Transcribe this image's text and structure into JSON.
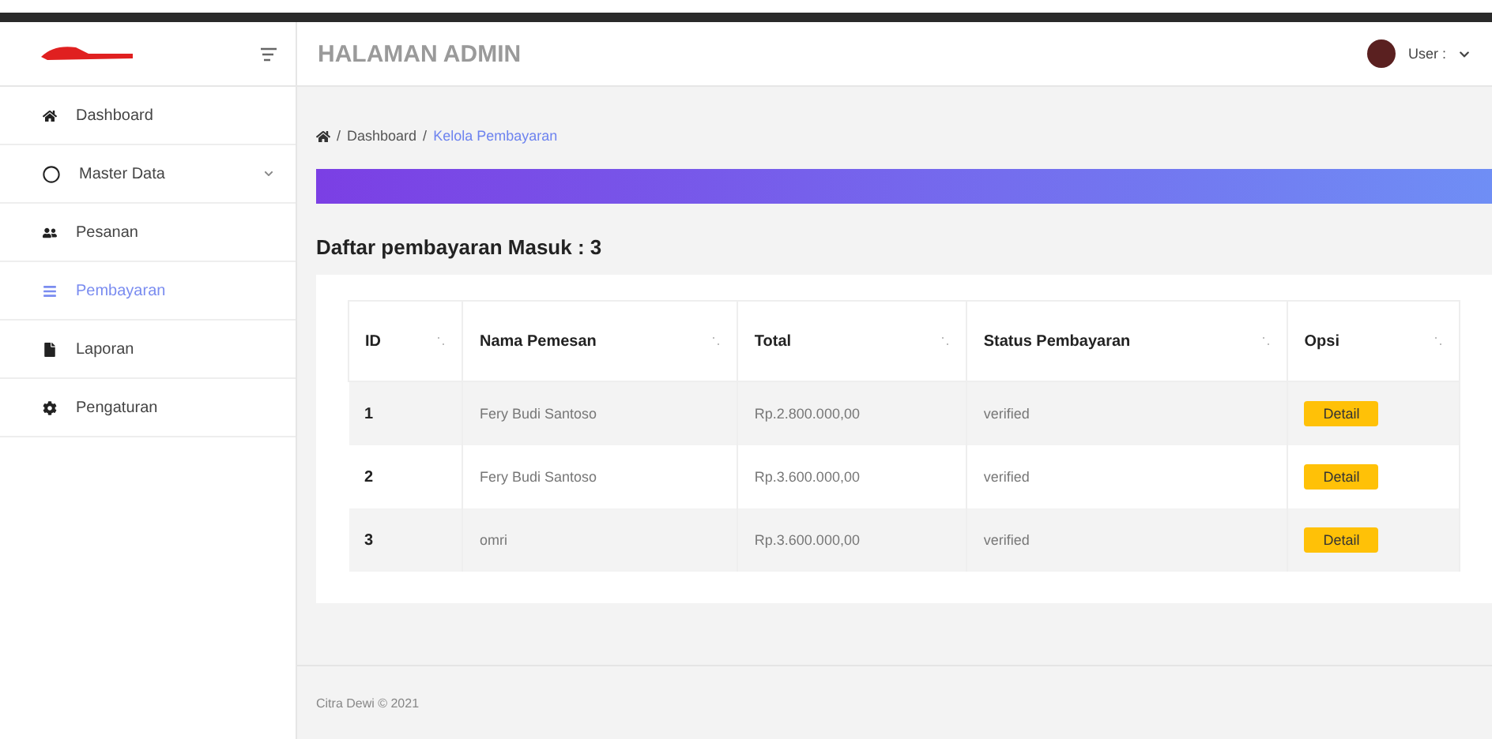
{
  "header": {
    "title": "HALAMAN ADMIN",
    "user_label": "User :"
  },
  "sidebar": {
    "items": [
      {
        "label": "Dashboard",
        "selected": false,
        "expandable": false
      },
      {
        "label": "Master Data",
        "selected": false,
        "expandable": true
      },
      {
        "label": "Pesanan",
        "selected": false,
        "expandable": false
      },
      {
        "label": "Pembayaran",
        "selected": true,
        "expandable": false
      },
      {
        "label": "Laporan",
        "selected": false,
        "expandable": false
      },
      {
        "label": "Pengaturan",
        "selected": false,
        "expandable": false
      }
    ]
  },
  "breadcrumb": [
    {
      "separator": "/",
      "label": "Dashboard",
      "current": false
    },
    {
      "separator": "/",
      "label": "Kelola Pembayaran",
      "current": true
    }
  ],
  "heading": "Daftar pembayaran Masuk : 3",
  "table": {
    "columns": [
      "ID",
      "Nama Pemesan",
      "Total",
      "Status Pembayaran",
      "Opsi"
    ],
    "rows": [
      {
        "id": "1",
        "name": "Fery Budi Santoso",
        "total": "Rp.2.800.000,00",
        "status": "verified",
        "action": "Detail"
      },
      {
        "id": "2",
        "name": "Fery Budi Santoso",
        "total": "Rp.3.600.000,00",
        "status": "verified",
        "action": "Detail"
      },
      {
        "id": "3",
        "name": "omri",
        "total": "Rp.3.600.000,00",
        "status": "verified",
        "action": "Detail"
      }
    ]
  },
  "footer": "Citra Dewi © 2021"
}
